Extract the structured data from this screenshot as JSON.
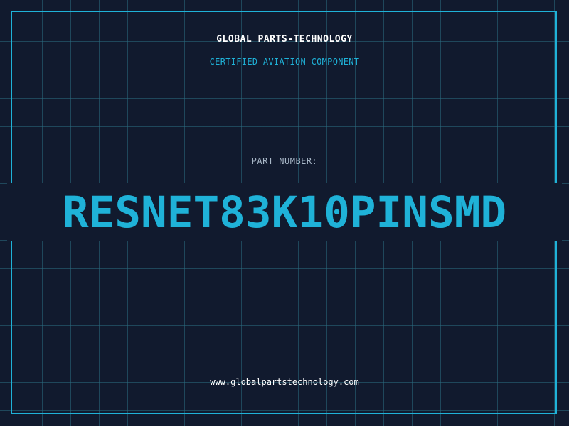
{
  "header": {
    "company": "GLOBAL PARTS-TECHNOLOGY",
    "subtitle": "CERTIFIED AVIATION COMPONENT"
  },
  "part": {
    "label": "PART NUMBER:",
    "number": "RESNET83K10PINSMD"
  },
  "footer": {
    "website": "www.globalpartstechnology.com"
  },
  "colors": {
    "background": "#111a2e",
    "accent": "#1fb2d8",
    "grid": "#2a6c80",
    "label": "#a9b8c8",
    "text": "#ffffff"
  }
}
